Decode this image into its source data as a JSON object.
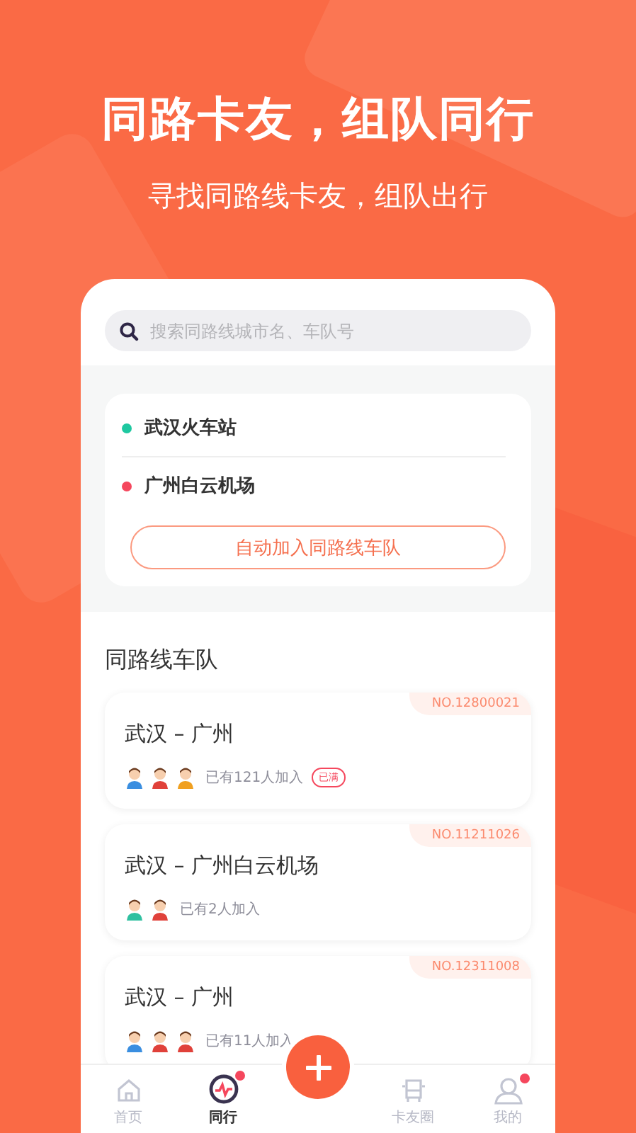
{
  "headline": "同路卡友，组队同行",
  "subheadline": "寻找同路线卡友，组队出行",
  "search": {
    "placeholder": "搜索同路线城市名、车队号"
  },
  "route": {
    "stops": [
      {
        "name": "武汉火车站",
        "color": "#1ec8a0"
      },
      {
        "name": "广州白云机场",
        "color": "#f5475d"
      }
    ],
    "button": "自动加入同路线车队"
  },
  "section_title": "同路线车队",
  "teams": [
    {
      "number": "NO.12800021",
      "title": "武汉 – 广州",
      "members": "已有121人加入",
      "full": true,
      "full_label": "已满",
      "avatars": [
        {
          "color": "#3a8ee0"
        },
        {
          "color": "#e0413a"
        },
        {
          "color": "#f0a020"
        }
      ]
    },
    {
      "number": "NO.11211026",
      "title": "武汉 – 广州白云机场",
      "members": "已有2人加入",
      "full": false,
      "avatars": [
        {
          "color": "#2fc0a0"
        },
        {
          "color": "#e0413a"
        }
      ]
    },
    {
      "number": "NO.12311008",
      "title": "武汉 – 广州",
      "members": "已有11人加入",
      "full": false,
      "avatars": [
        {
          "color": "#3a8ee0"
        },
        {
          "color": "#e0413a"
        },
        {
          "color": "#e0413a"
        }
      ]
    }
  ],
  "nav": [
    {
      "label": "首页",
      "kind": "home",
      "selected": false,
      "dot": false
    },
    {
      "label": "同行",
      "kind": "pulse",
      "selected": true,
      "dot": true
    },
    {
      "kind": "add"
    },
    {
      "label": "卡友圈",
      "kind": "truck",
      "selected": false,
      "dot": false
    },
    {
      "label": "我的",
      "kind": "user",
      "selected": false,
      "dot": true
    }
  ]
}
